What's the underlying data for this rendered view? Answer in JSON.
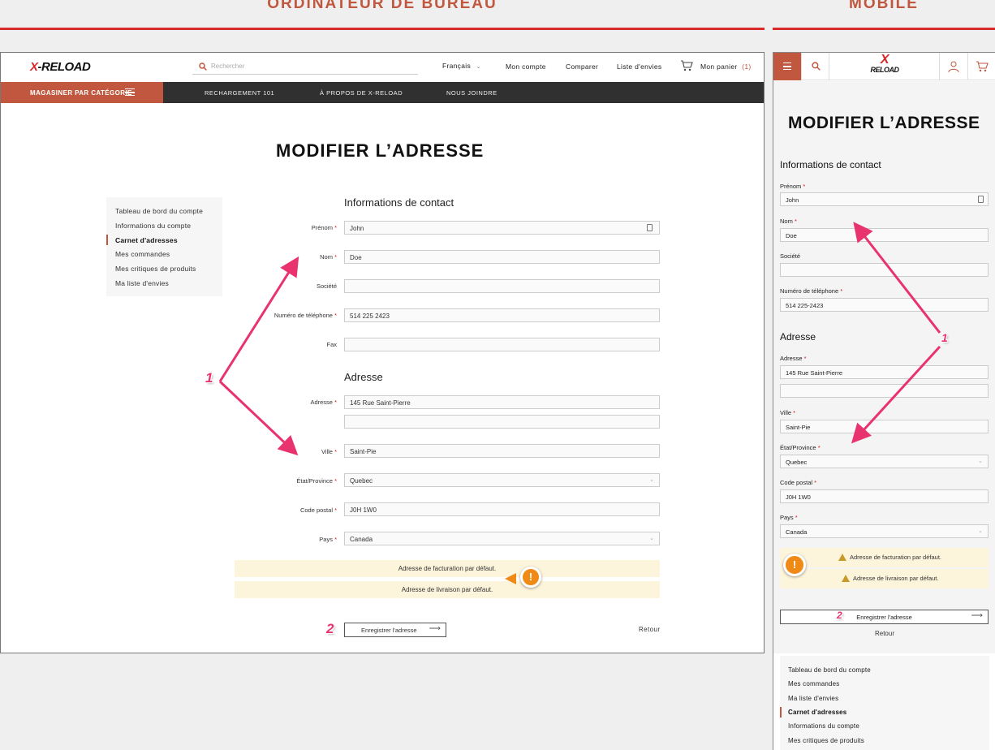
{
  "sections": {
    "desktop": "ORDINATEUR DE BUREAU",
    "mobile": "MOBILE"
  },
  "brand": {
    "x": "X",
    "rest": "-RELOAD",
    "mobile_top": "X",
    "mobile_bottom": "RELOAD"
  },
  "header": {
    "search_placeholder": "Rechercher",
    "language": "Français",
    "account": "Mon compte",
    "compare": "Comparer",
    "wishlist": "Liste d'envies",
    "cart": "Mon panier",
    "cart_count": "(1)"
  },
  "nav": {
    "category": "MAGASINER PAR CATÉGORIE",
    "items": [
      "RECHARGEMENT 101",
      "À PROPOS DE X-RELOAD",
      "NOUS JOINDRE"
    ]
  },
  "page_title": "MODIFIER L’ADRESSE",
  "sidebar": {
    "desktop": [
      "Tableau de bord du compte",
      "Informations du compte",
      "Carnet d'adresses",
      "Mes commandes",
      "Mes critiques de produits",
      "Ma liste d'envies"
    ],
    "mobile": [
      "Tableau de bord du compte",
      "Mes commandes",
      "Ma liste d'envies",
      "Carnet d'adresses",
      "Informations du compte",
      "Mes critiques de produits"
    ]
  },
  "contact": {
    "heading": "Informations de contact",
    "first_name_label": "Prénom",
    "first_name": "John",
    "last_name_label": "Nom",
    "last_name": "Doe",
    "company_label": "Société",
    "company": "",
    "phone_label": "Numéro de téléphone",
    "phone_desktop": "514 225 2423",
    "phone_mobile": "514 225-2423",
    "fax_label": "Fax",
    "fax": ""
  },
  "address": {
    "heading": "Adresse",
    "street_label": "Adresse",
    "street": "145 Rue Saint-Pierre",
    "street2": "",
    "city_label": "Ville",
    "city": "Saint-Pie",
    "state_label": "État/Province",
    "state": "Quebec",
    "zip_label": "Code postal",
    "zip": "J0H 1W0",
    "country_label": "Pays",
    "country": "Canada"
  },
  "required_mark": "*",
  "notices": {
    "billing": "Adresse de facturation par défaut.",
    "shipping": "Adresse de livraison par défaut.",
    "badge": "!"
  },
  "actions": {
    "save": "Enregistrer l'adresse",
    "back": "Retour"
  },
  "annotations": {
    "one": "1",
    "two": "2"
  },
  "colors": {
    "accent": "#c0573e",
    "nav_dark": "#303030",
    "notice_bg": "#fdf4dc",
    "annotation": "#e8336f",
    "warning": "#f08a16"
  }
}
